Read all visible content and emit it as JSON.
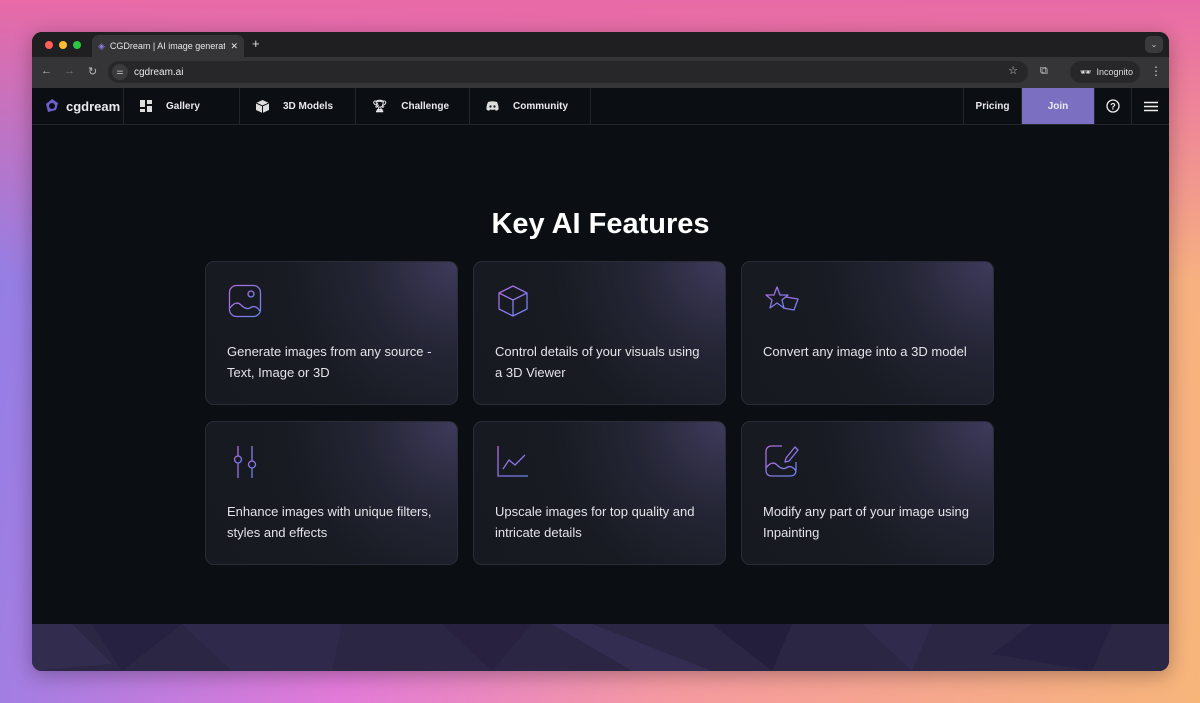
{
  "browser": {
    "tab_title": "CGDream | AI image generator",
    "url": "cgdream.ai",
    "incognito_label": "Incognito"
  },
  "nav": {
    "logo_text": "cgdream",
    "items": [
      {
        "label": "Gallery",
        "icon": "grid-icon"
      },
      {
        "label": "3D Models",
        "icon": "cube-icon"
      },
      {
        "label": "Challenge",
        "icon": "trophy-icon"
      },
      {
        "label": "Community",
        "icon": "discord-icon"
      }
    ],
    "pricing": "Pricing",
    "join": "Join"
  },
  "colors": {
    "join": "#7a6fc0",
    "background": "#0b0e13",
    "icon_gradient": [
      "#a46be0",
      "#6f7cf0"
    ]
  },
  "main": {
    "title": "Key AI Features",
    "features": [
      {
        "icon": "image-icon",
        "text": "Generate images from any source - Text, Image or 3D"
      },
      {
        "icon": "cube-icon",
        "text": "Control details of your visuals using a 3D Viewer"
      },
      {
        "icon": "stars-icon",
        "text": "Convert any image into a 3D model"
      },
      {
        "icon": "sliders-icon",
        "text": "Enhance images with unique filters, styles and effects"
      },
      {
        "icon": "chart-line-icon",
        "text": "Upscale images for top quality and intricate details"
      },
      {
        "icon": "image-edit-icon",
        "text": "Modify any part of your image using Inpainting"
      }
    ]
  }
}
